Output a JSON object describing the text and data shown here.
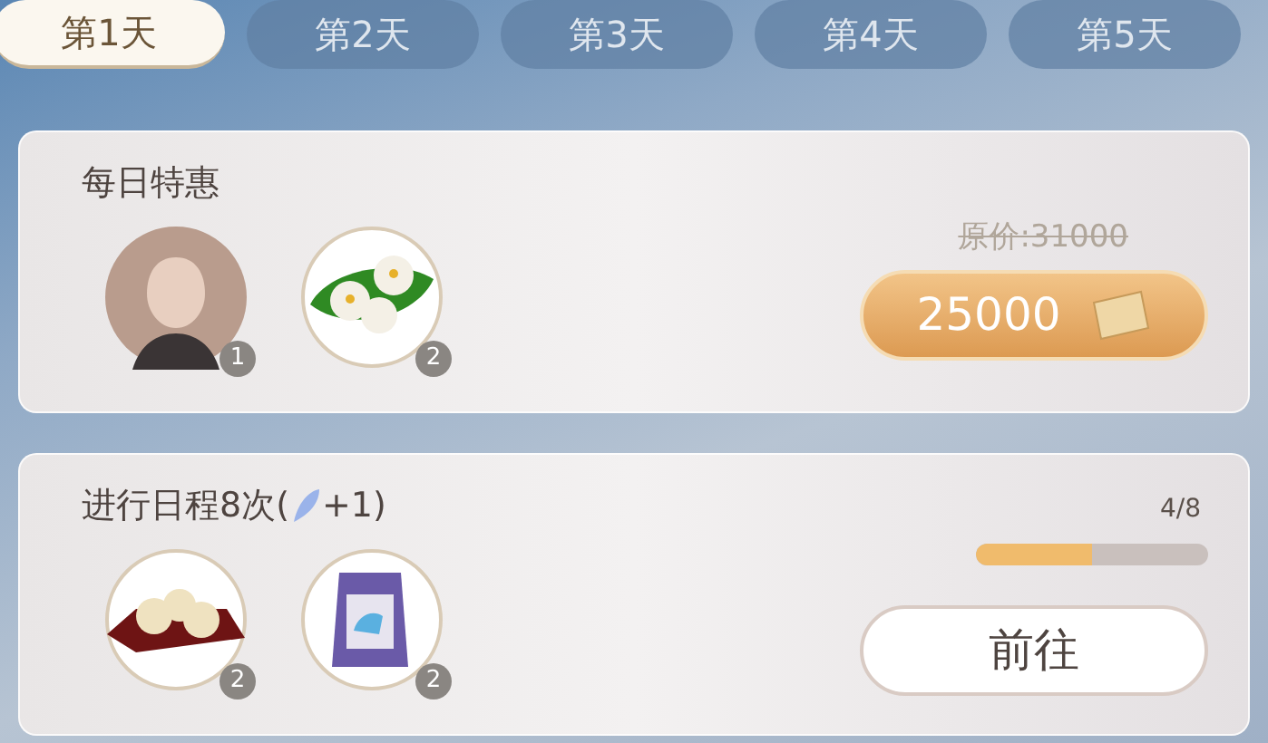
{
  "tabs": [
    {
      "label": "第1天",
      "selected": true
    },
    {
      "label": "第2天",
      "selected": false
    },
    {
      "label": "第3天",
      "selected": false
    },
    {
      "label": "第4天",
      "selected": false
    },
    {
      "label": "第5天",
      "selected": false
    }
  ],
  "cards": [
    {
      "kind": "offer",
      "title": "每日特惠",
      "rewards": [
        {
          "kind": "character",
          "count": "1"
        },
        {
          "kind": "cakes",
          "count": "2"
        }
      ],
      "original_price": "原价:31000",
      "price": "25000"
    },
    {
      "kind": "task",
      "title_prefix": "进行日程8次(",
      "title_suffix": "+1)",
      "rewards": [
        {
          "kind": "buns",
          "count": "2"
        },
        {
          "kind": "bag",
          "count": "2"
        }
      ],
      "progress": "4/8",
      "level": 0.5,
      "button": "前往"
    }
  ]
}
